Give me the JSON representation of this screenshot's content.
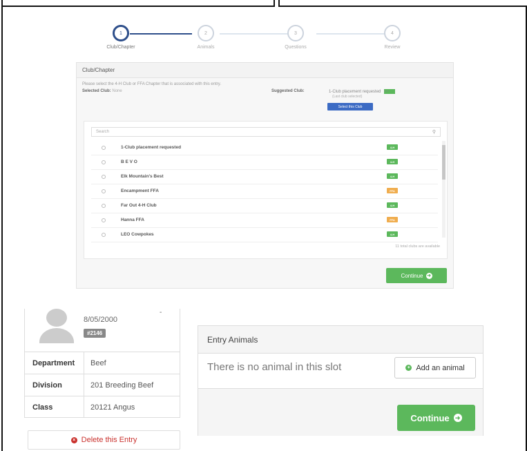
{
  "wizard": {
    "steps": [
      {
        "num": "1",
        "label": "Club/Chapter",
        "active": true
      },
      {
        "num": "2",
        "label": "Animals",
        "active": false
      },
      {
        "num": "3",
        "label": "Questions",
        "active": false
      },
      {
        "num": "4",
        "label": "Review",
        "active": false
      }
    ]
  },
  "club_panel": {
    "title": "Club/Chapter",
    "description": "Please select the 4-H Club or FFA Chapter that is associated with this entry.",
    "selected_label": "Selected Club:",
    "selected_value": "None",
    "suggested_label": "Suggested Club:",
    "suggested_value": "1-Club placement requested",
    "suggested_tag": "4-H",
    "suggested_sub": "(Last club selected)",
    "select_button": "Select this Club",
    "search_placeholder": "Search",
    "clubs": [
      {
        "name": "1-Club placement requested",
        "tag": "4-H",
        "type": "h"
      },
      {
        "name": "B E V O",
        "tag": "4-H",
        "type": "h"
      },
      {
        "name": "Elk Mountain's Best",
        "tag": "4-H",
        "type": "h"
      },
      {
        "name": "Encampment FFA",
        "tag": "FFA",
        "type": "f"
      },
      {
        "name": "Far Out 4-H Club",
        "tag": "4-H",
        "type": "h"
      },
      {
        "name": "Hanna FFA",
        "tag": "FFA",
        "type": "f"
      },
      {
        "name": "LEO Cowpokes",
        "tag": "4-H",
        "type": "h"
      }
    ],
    "available_text": "11 total clubs are available",
    "continue_label": "Continue"
  },
  "entry": {
    "date": "8/05/2000",
    "dash": "-",
    "id": "#2146",
    "rows": [
      {
        "key": "Department",
        "value": "Beef"
      },
      {
        "key": "Division",
        "value": "201 Breeding Beef"
      },
      {
        "key": "Class",
        "value": "20121 Angus"
      }
    ],
    "delete_label": "Delete this Entry"
  },
  "animals": {
    "title": "Entry Animals",
    "empty_text": "There is no animal in this slot",
    "add_label": "Add an animal",
    "continue_label": "Continue"
  },
  "colors": {
    "primary": "#2d4e8a",
    "success": "#5cb85c",
    "warning": "#f0ad4e",
    "danger": "#c9302c",
    "select_button": "#3c6bc4"
  },
  "icons": [
    "search-icon",
    "arrow-circle-right-icon",
    "plus-circle-icon",
    "times-circle-icon",
    "avatar-placeholder-icon",
    "radio-icon"
  ]
}
